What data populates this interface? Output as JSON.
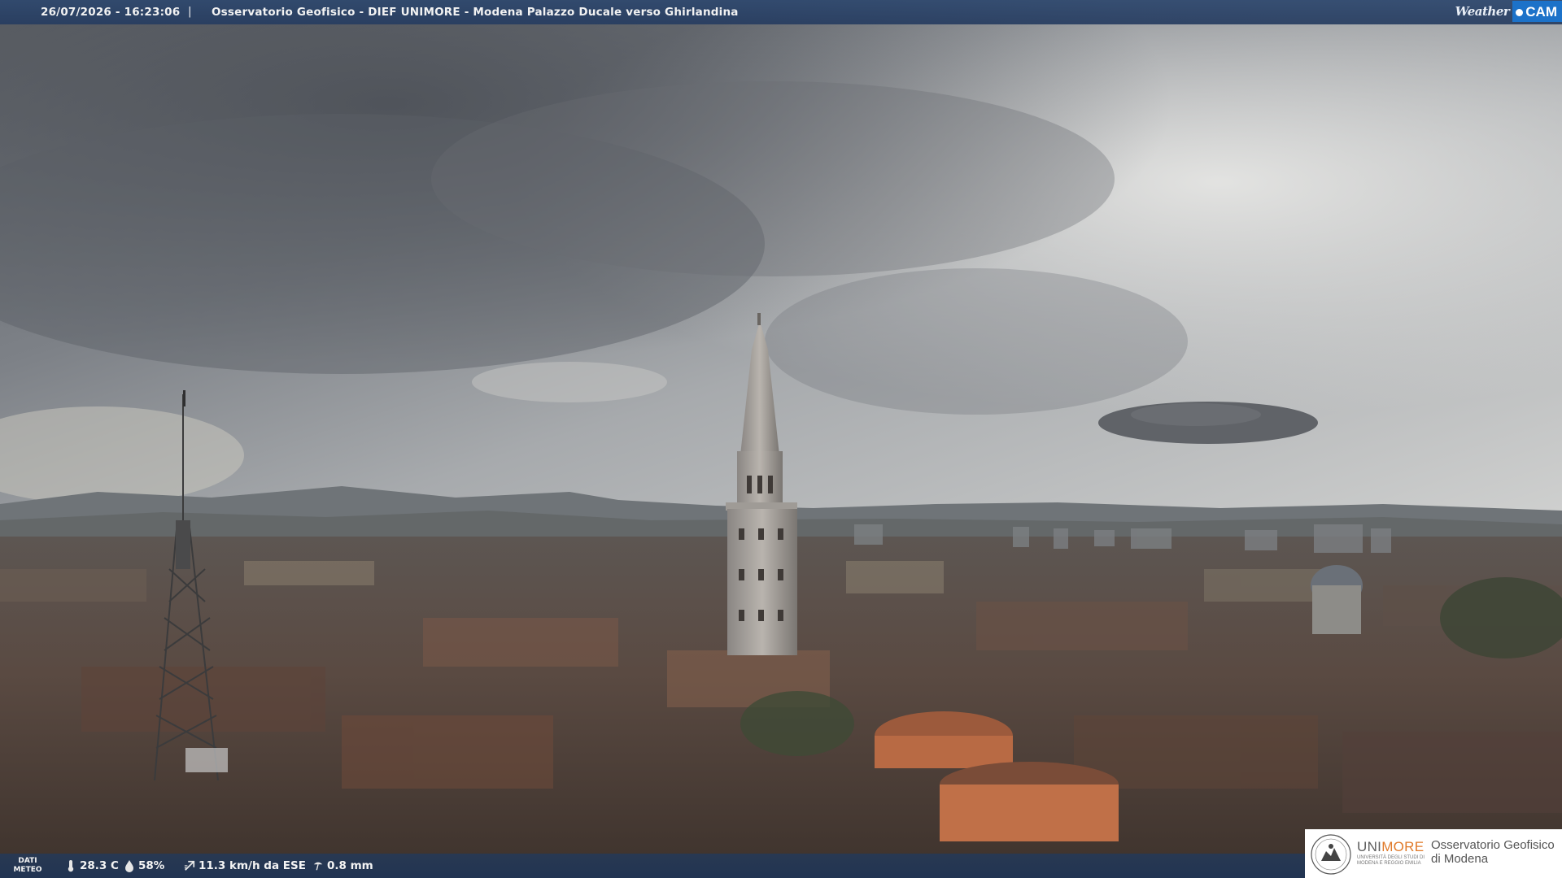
{
  "header": {
    "timestamp": "26/07/2026 - 16:23:06",
    "separator": "|",
    "title": "Osservatorio Geofisico - DIEF UNIMORE - Modena Palazzo Ducale verso Ghirlandina",
    "brand_word": "Weather",
    "brand_cam": "CAM"
  },
  "meteo": {
    "label_line1": "DATI",
    "label_line2": "METEO",
    "temperature": "28.3 C",
    "humidity": "58%",
    "wind": "11.3 km/h da ESE",
    "rain": "0.8 mm",
    "icons": [
      "thermometer-icon",
      "humidity-drop-icon",
      "wind-icon",
      "rain-gauge-icon"
    ]
  },
  "logo": {
    "uni_prefix": "UNI",
    "uni_suffix": "MORE",
    "uni_sub": "UNIVERSITÀ DEGLI STUDI DI MODENA E REGGIO EMILIA",
    "obs_line1": "Osservatorio Geofisico",
    "obs_line2": "di Modena"
  },
  "colors": {
    "bar": "#2e486e",
    "brand_blue": "#1c72c9",
    "unimore_orange": "#e07a2a"
  }
}
